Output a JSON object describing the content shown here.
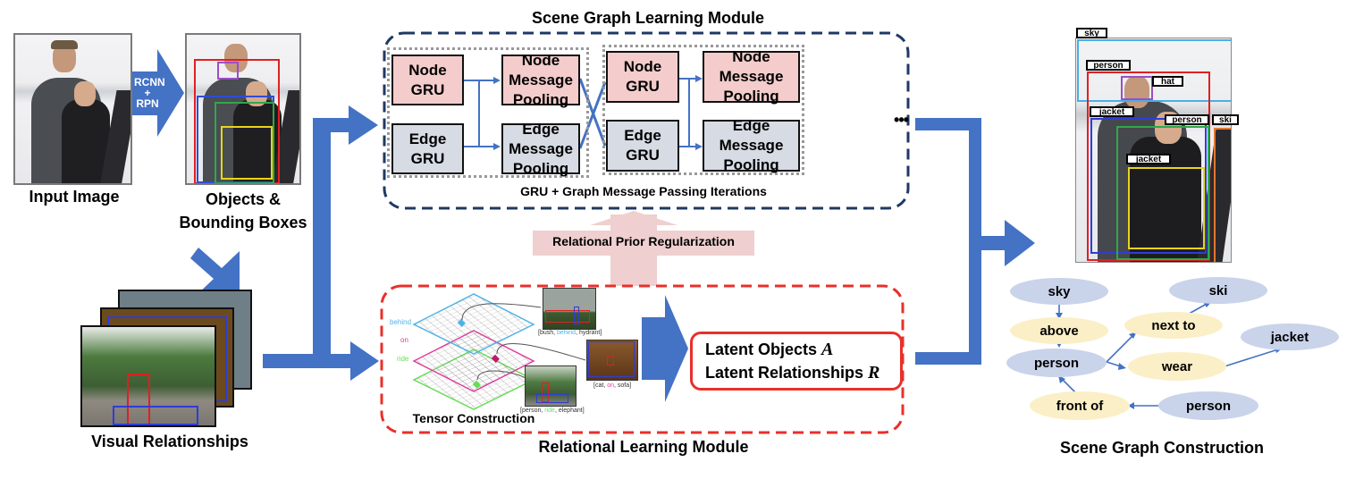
{
  "left_panel": {
    "input_image_label": "Input Image",
    "detector_arrow_label_line1": "RCNN",
    "detector_arrow_label_line2": "+",
    "detector_arrow_label_line3": "RPN",
    "objects_label_line1": "Objects &",
    "objects_label_line2": "Bounding Boxes",
    "visual_relationships_label": "Visual Relationships"
  },
  "scene_graph_module": {
    "title": "Scene Graph Learning Module",
    "iteration_caption": "GRU + Graph Message Passing Iterations",
    "continuation": "•••",
    "iterations": [
      {
        "node_gru": "Node GRU",
        "edge_gru": "Edge GRU",
        "node_pool_line1": "Node Message",
        "node_pool_line2": "Pooling",
        "edge_pool_line1": "Edge Message",
        "edge_pool_line2": "Pooling"
      },
      {
        "node_gru": "Node GRU",
        "edge_gru": "Edge GRU",
        "node_pool_line1": "Node Message",
        "node_pool_line2": "Pooling",
        "edge_pool_line1": "Edge Message",
        "edge_pool_line2": "Pooling"
      }
    ]
  },
  "regularization_label": "Relational Prior Regularization",
  "relational_module": {
    "title": "Relational Learning Module",
    "tensor_caption": "Tensor Construction",
    "layers": [
      {
        "name": "behind",
        "color": "#4fb3e8"
      },
      {
        "name": "on",
        "color": "#e0409a"
      },
      {
        "name": "ride",
        "color": "#66dd55"
      }
    ],
    "examples": [
      {
        "subject": "bush",
        "predicate": "behind",
        "object": "hydrant",
        "color": "#4fb3e8"
      },
      {
        "subject": "cat",
        "predicate": "on",
        "object": "sofa",
        "color": "#e0409a"
      },
      {
        "subject": "person",
        "predicate": "ride",
        "object": "elephant",
        "color": "#66dd55"
      }
    ],
    "latent_line1": "Latent Objects",
    "latent_var1": "A",
    "latent_line2": "Latent Relationships",
    "latent_var2": "R"
  },
  "scene_graph_output": {
    "title": "Scene Graph Construction",
    "detections": [
      "sky",
      "person",
      "hat",
      "jacket",
      "person",
      "ski",
      "jacket"
    ],
    "nodes": {
      "sky": "sky",
      "above": "above",
      "person_main": "person",
      "next_to": "next to",
      "ski": "ski",
      "wear": "wear",
      "jacket": "jacket",
      "front_of": "front of",
      "person_second": "person"
    }
  },
  "colors": {
    "flow_arrow": "#4472c4",
    "sg_module_border": "#1f3864",
    "rl_module_border": "#e8302a",
    "node_fill": "#f4cccc",
    "edge_fill": "#d6dbe4",
    "object_node": "#c9d3ea",
    "relation_node": "#fbefc7",
    "regularization_arrow": "#efcfcf"
  }
}
